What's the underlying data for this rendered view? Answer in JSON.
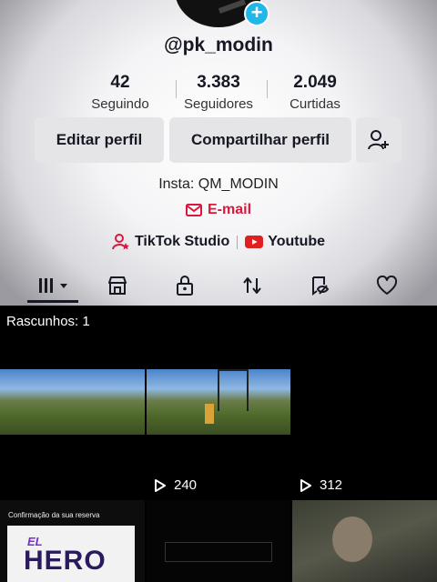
{
  "profile": {
    "username": "@pk_modin",
    "stats": [
      {
        "value": "42",
        "label": "Seguindo"
      },
      {
        "value": "3.383",
        "label": "Seguidores"
      },
      {
        "value": "2.049",
        "label": "Curtidas"
      }
    ],
    "buttons": {
      "edit": "Editar perfil",
      "share": "Compartilhar perfil"
    },
    "bio": "Insta: QM_MODIN",
    "email_label": "E-mail",
    "links": {
      "studio": "TikTok Studio",
      "youtube": "Youtube"
    }
  },
  "tabs": [
    "videos-grid-icon",
    "shop-icon",
    "lock-icon",
    "repost-icon",
    "favorites-icon",
    "heart-icon"
  ],
  "grid": {
    "drafts_label": "Rascunhos: 1",
    "items": [
      {
        "plays": "240"
      },
      {
        "plays": "312"
      }
    ],
    "row3_text": {
      "reservation": "Confirmação da sua reserva",
      "hero": "HERO",
      "el": "EL"
    }
  },
  "colors": {
    "accent_red": "#d8193e",
    "add_badge": "#20b8e8",
    "youtube_red": "#e0201f"
  }
}
